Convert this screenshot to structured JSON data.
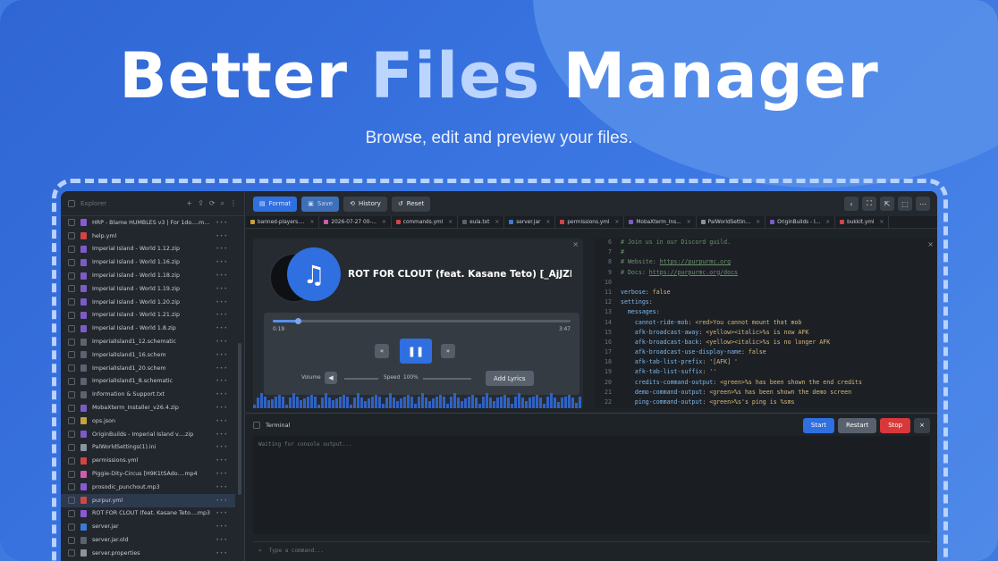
{
  "promo": {
    "title_part1": "Better ",
    "title_highlight": "Files",
    "title_part2": " Manager",
    "tagline": "Browse, edit and preview your files."
  },
  "sidebar": {
    "title": "Explorer",
    "tools": [
      "+",
      "⇪",
      "⟳",
      "⌕",
      "⋮"
    ],
    "items": [
      {
        "name": "HRP - Blame HUMBLES v3 | For 1do....mp3",
        "icon": "audio",
        "color": "#8a5ad6"
      },
      {
        "name": "help.yml",
        "icon": "yaml",
        "color": "#d24545"
      },
      {
        "name": "Imperial Island - World 1.12.zip",
        "icon": "zip",
        "color": "#7d5bc7"
      },
      {
        "name": "Imperial Island - World 1.16.zip",
        "icon": "zip",
        "color": "#7d5bc7"
      },
      {
        "name": "Imperial Island - World 1.18.zip",
        "icon": "zip",
        "color": "#7d5bc7"
      },
      {
        "name": "Imperial Island - World 1.19.zip",
        "icon": "zip",
        "color": "#7d5bc7"
      },
      {
        "name": "Imperial Island - World 1.20.zip",
        "icon": "zip",
        "color": "#7d5bc7"
      },
      {
        "name": "Imperial Island - World 1.21.zip",
        "icon": "zip",
        "color": "#7d5bc7"
      },
      {
        "name": "Imperial Island - World 1.8.zip",
        "icon": "zip",
        "color": "#7d5bc7"
      },
      {
        "name": "ImperialIsland1_12.schematic",
        "icon": "file",
        "color": "#5b636e"
      },
      {
        "name": "ImperialIsland1_16.schem",
        "icon": "file",
        "color": "#5b636e"
      },
      {
        "name": "ImperialIsland1_20.schem",
        "icon": "file",
        "color": "#5b636e"
      },
      {
        "name": "ImperialIsland1_8.schematic",
        "icon": "file",
        "color": "#5b636e"
      },
      {
        "name": "Information & Support.txt",
        "icon": "text",
        "color": "#5b636e"
      },
      {
        "name": "MobaXterm_Installer_v26.4.zip",
        "icon": "zip",
        "color": "#7d5bc7"
      },
      {
        "name": "ops.json",
        "icon": "json",
        "color": "#c9a13a"
      },
      {
        "name": "OriginBuilds - Imperial Island v....zip",
        "icon": "zip",
        "color": "#7d5bc7"
      },
      {
        "name": "PalWorldSettings(1).ini",
        "icon": "gear",
        "color": "#8b939d"
      },
      {
        "name": "permissions.yml",
        "icon": "yaml",
        "color": "#d24545"
      },
      {
        "name": "Piggie-Dity-Circus [H9K1tSAdo....mp4",
        "icon": "video",
        "color": "#d25ab0"
      },
      {
        "name": "prosodic_punchout.mp3",
        "icon": "audio",
        "color": "#8a5ad6"
      },
      {
        "name": "purpur.yml",
        "icon": "yaml",
        "color": "#d24545"
      },
      {
        "name": "ROT FOR CLOUT (feat. Kasane Teto....mp3",
        "icon": "audio",
        "color": "#8a5ad6"
      },
      {
        "name": "server.jar",
        "icon": "jar",
        "color": "#3a7bd5"
      },
      {
        "name": "server.jar.old",
        "icon": "file",
        "color": "#5b636e"
      },
      {
        "name": "server.properties",
        "icon": "gear",
        "color": "#8b939d"
      }
    ],
    "active_index": 21
  },
  "toolbar": {
    "format_label": "Format",
    "save_label": "Save",
    "history_label": "History",
    "reset_label": "Reset",
    "right_icons": [
      "‹",
      "⛶",
      "⇱",
      "⬚",
      "⋯"
    ]
  },
  "tabs": [
    {
      "label": "banned-players....",
      "color": "#c9a13a"
    },
    {
      "label": "2026-07-27 00-...",
      "color": "#d25ab0"
    },
    {
      "label": "commands.yml",
      "color": "#d24545"
    },
    {
      "label": "eula.txt",
      "color": "#5b636e"
    },
    {
      "label": "server.jar",
      "color": "#3a7bd5"
    },
    {
      "label": "permissions.yml",
      "color": "#d24545"
    },
    {
      "label": "MobaXterm_Ins...",
      "color": "#7d5bc7"
    },
    {
      "label": "PalWorldSettin...",
      "color": "#8b939d"
    },
    {
      "label": "OriginBuilds - I...",
      "color": "#7d5bc7"
    },
    {
      "label": "bukkit.yml",
      "color": "#d24545"
    }
  ],
  "player": {
    "title": "ROT FOR CLOUT (feat. Kasane Teto) [_AjJZEcM...",
    "current_time": "0:19",
    "total_time": "3:47",
    "progress": 0.084,
    "volume_label": "Volume",
    "speed_label": "Speed",
    "speed_value": "100%",
    "lyrics_label": "Add Lyrics"
  },
  "code": {
    "lines": [
      {
        "n": "6",
        "parts": [
          {
            "t": "# Join us in our Discord guild.",
            "c": "cm"
          }
        ]
      },
      {
        "n": "7",
        "parts": [
          {
            "t": "#",
            "c": "cm"
          }
        ]
      },
      {
        "n": "8",
        "parts": [
          {
            "t": "# Website: ",
            "c": "cm"
          },
          {
            "t": "https://purpurmc.org",
            "c": "lk"
          }
        ]
      },
      {
        "n": "9",
        "parts": [
          {
            "t": "# Docs: ",
            "c": "cm"
          },
          {
            "t": "https://purpurmc.org/docs",
            "c": "lk"
          }
        ]
      },
      {
        "n": "10",
        "parts": [
          {
            "t": "",
            "c": "v"
          }
        ]
      },
      {
        "n": "11",
        "parts": [
          {
            "t": "verbose",
            "c": "k"
          },
          {
            "t": ": false",
            "c": "v"
          }
        ]
      },
      {
        "n": "12",
        "parts": [
          {
            "t": "settings",
            "c": "k"
          },
          {
            "t": ":",
            "c": "v"
          }
        ]
      },
      {
        "n": "13",
        "parts": [
          {
            "t": "  messages",
            "c": "k"
          },
          {
            "t": ":",
            "c": "v"
          }
        ]
      },
      {
        "n": "14",
        "parts": [
          {
            "t": "    cannot-ride-mob",
            "c": "k"
          },
          {
            "t": ": <red>You cannot mount that mob",
            "c": "v"
          }
        ]
      },
      {
        "n": "15",
        "parts": [
          {
            "t": "    afk-broadcast-away",
            "c": "k"
          },
          {
            "t": ": <yellow><italic>%s is now AFK",
            "c": "v"
          }
        ]
      },
      {
        "n": "16",
        "parts": [
          {
            "t": "    afk-broadcast-back",
            "c": "k"
          },
          {
            "t": ": <yellow><italic>%s is no longer AFK",
            "c": "v"
          }
        ]
      },
      {
        "n": "17",
        "parts": [
          {
            "t": "    afk-broadcast-use-display-name",
            "c": "k"
          },
          {
            "t": ": false",
            "c": "v"
          }
        ]
      },
      {
        "n": "18",
        "parts": [
          {
            "t": "    afk-tab-list-prefix",
            "c": "k"
          },
          {
            "t": ": '[AFK] '",
            "c": "v"
          }
        ]
      },
      {
        "n": "19",
        "parts": [
          {
            "t": "    afk-tab-list-suffix",
            "c": "k"
          },
          {
            "t": ": ''",
            "c": "v"
          }
        ]
      },
      {
        "n": "20",
        "parts": [
          {
            "t": "    credits-command-output",
            "c": "k"
          },
          {
            "t": ": <green>%s has been shown the end credits",
            "c": "v"
          }
        ]
      },
      {
        "n": "21",
        "parts": [
          {
            "t": "    demo-command-output",
            "c": "k"
          },
          {
            "t": ": <green>%s has been shown the demo screen",
            "c": "v"
          }
        ]
      },
      {
        "n": "22",
        "parts": [
          {
            "t": "    ping-command-output",
            "c": "k"
          },
          {
            "t": ": <green>%s's ping is %sms",
            "c": "v"
          }
        ]
      }
    ]
  },
  "terminal": {
    "title": "Terminal",
    "start_label": "Start",
    "restart_label": "Restart",
    "stop_label": "Stop",
    "close_label": "×",
    "output": "Waiting for console output...",
    "input_placeholder": "Type a command...",
    "colors": {
      "start": "#2f6fe0",
      "restart": "#59616c",
      "stop": "#d9383a"
    }
  }
}
